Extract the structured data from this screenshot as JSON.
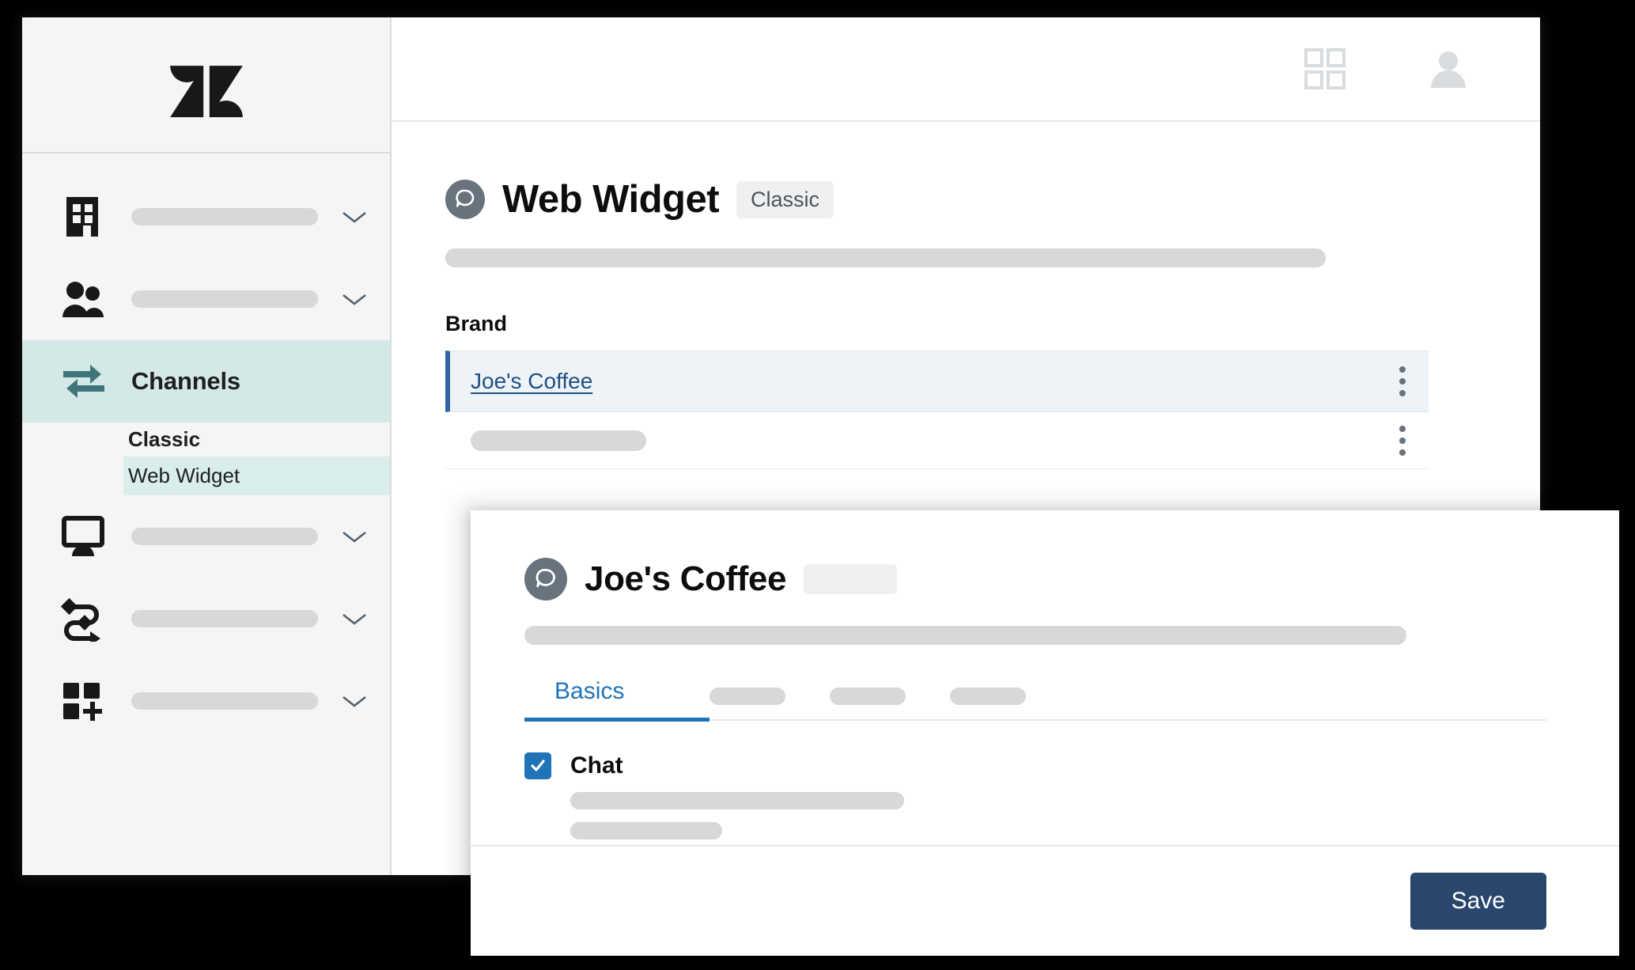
{
  "window": {
    "topbar": {
      "grid_icon": "grid-icon",
      "avatar_icon": "user-avatar-icon"
    }
  },
  "sidebar": {
    "logo": "zendesk-logo",
    "items": [
      {
        "icon": "building-icon",
        "label": "",
        "placeholder": true,
        "chevron": true,
        "active": false
      },
      {
        "icon": "people-icon",
        "label": "",
        "placeholder": true,
        "chevron": true,
        "active": false
      },
      {
        "icon": "channels-arrows-icon",
        "label": "Channels",
        "placeholder": false,
        "chevron": false,
        "active": true
      },
      {
        "icon": "monitor-icon",
        "label": "",
        "placeholder": true,
        "chevron": true,
        "active": false
      },
      {
        "icon": "workflow-icon",
        "label": "",
        "placeholder": true,
        "chevron": true,
        "active": false
      },
      {
        "icon": "apps-add-icon",
        "label": "",
        "placeholder": true,
        "chevron": true,
        "active": false
      }
    ],
    "sub_group_label": "Classic",
    "sub_item_label": "Web Widget"
  },
  "main": {
    "title": "Web Widget",
    "title_badge": "Classic",
    "title_icon": "chat-bubble-icon",
    "brand_section_label": "Brand",
    "brand_rows": [
      {
        "name": "Joe's Coffee",
        "selected": true,
        "menu": "kebab-menu-icon"
      },
      {
        "name": "",
        "selected": false,
        "placeholder": true,
        "menu": "kebab-menu-icon"
      }
    ]
  },
  "modal": {
    "title": "Joe's Coffee",
    "title_icon": "chat-bubble-icon",
    "tabs": [
      {
        "label": "Basics",
        "active": true
      },
      {
        "label": "",
        "active": false,
        "placeholder": true
      },
      {
        "label": "",
        "active": false,
        "placeholder": true
      },
      {
        "label": "",
        "active": false,
        "placeholder": true
      }
    ],
    "chat_checkbox": {
      "label": "Chat",
      "checked": true
    },
    "save_label": "Save"
  },
  "colors": {
    "accent_teal": "#d4e9e7",
    "sub_item_teal": "#d9eeeb",
    "link_blue": "#1f4f82",
    "tab_blue": "#1f73b7",
    "checkbox_blue": "#1f73b7",
    "save_navy": "#29466c",
    "selected_row_bg": "#eef3f8",
    "selected_row_border": "#2f65a7",
    "placeholder_gray": "#d8d8d8",
    "icon_gray": "#68737d",
    "sidebar_bg": "#f5f5f5"
  }
}
